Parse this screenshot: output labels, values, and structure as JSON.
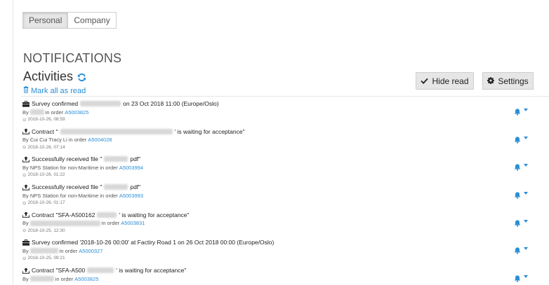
{
  "tabs": [
    {
      "label": "Personal",
      "active": true
    },
    {
      "label": "Company",
      "active": false
    }
  ],
  "section_title": "NOTIFICATIONS",
  "activities_title": "Activities",
  "mark_all_label": "Mark all as read",
  "hide_read_label": "Hide read",
  "settings_label": "Settings",
  "colors": {
    "link": "#2a8fd8",
    "button_bg": "#e6e6e6"
  },
  "notifications": [
    {
      "icon": "briefcase-icon",
      "title_pre": "Survey confirmed ",
      "title_post": " on 23 Oct 2018 11:00 (Europe/Oslo)",
      "by_label": "By ",
      "in_order": " in order ",
      "order": "A5003825",
      "time": "2018-10-26, 08:59"
    },
    {
      "icon": "upload-icon",
      "title_pre": "Contract \"",
      "title_post": "' is waiting for acceptance\"",
      "by_label": "By Cui Cui Tracy Li",
      "in_order": " in order ",
      "order": "A5004028",
      "time": "2018-10-26, 07:14"
    },
    {
      "icon": "upload-icon",
      "title_pre": "Successfully received file \"",
      "title_post": "pdf\"",
      "by_label": "By NPS Station for non-Maritime",
      "in_order": " in order ",
      "order": "A5003994",
      "time": "2018-10-26, 01:22"
    },
    {
      "icon": "upload-icon",
      "title_pre": "Successfully received file \"",
      "title_post": "pdf\"",
      "by_label": "By NPS Station for non-Maritime",
      "in_order": " in order ",
      "order": "A5003993",
      "time": "2018-10-26, 01:17"
    },
    {
      "icon": "upload-icon",
      "title_pre": "Contract \"SFA-A500162",
      "title_post": "' is waiting for acceptance\"",
      "by_label": "By ",
      "in_order": " in order ",
      "order": "A5003831",
      "time": "2018-10-25, 12:30"
    },
    {
      "icon": "briefcase-icon",
      "title_pre": "Survey confirmed '2018-10-26 00:00' at Factiry Road 1 on 26 Oct 2018 00:00 (Europe/Oslo)",
      "title_post": "",
      "by_label": "By ",
      "in_order": " in order ",
      "order": "A5000327",
      "time": "2018-10-25, 09:21"
    },
    {
      "icon": "upload-icon",
      "title_pre": "Contract \"SFA-A500",
      "title_post": "' is waiting for acceptance\"",
      "by_label": "By ",
      "in_order": " in order ",
      "order": "A5003825",
      "time": ""
    }
  ]
}
